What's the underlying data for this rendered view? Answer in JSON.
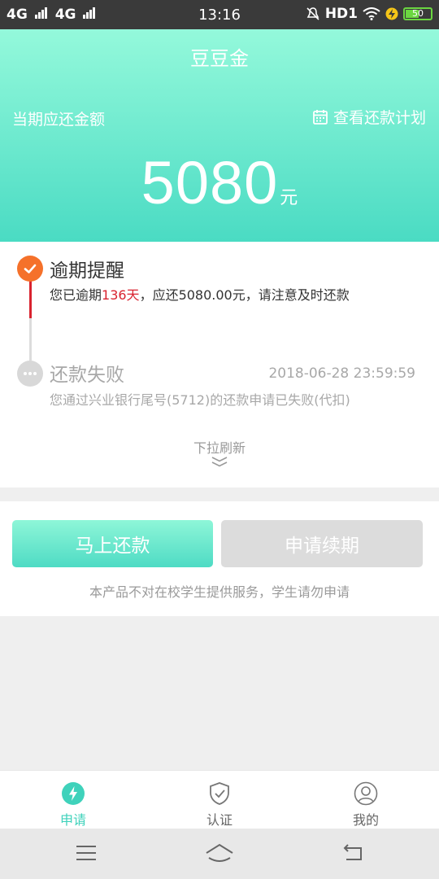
{
  "status_bar": {
    "network1": "4G",
    "network2": "4G",
    "time": "13:16",
    "hd_label": "HD1",
    "battery": "50"
  },
  "header": {
    "title": "豆豆金",
    "due_label": "当期应还金额",
    "plan_link": "查看还款计划",
    "amount": "5080",
    "amount_unit": "元"
  },
  "timeline": [
    {
      "title": "逾期提醒",
      "desc_prefix": "您已逾期",
      "desc_highlight": "136天",
      "desc_suffix": "，应还5080.00元，请注意及时还款"
    },
    {
      "title": "还款失败",
      "time": "2018-06-28 23:59:59",
      "desc": "您通过兴业银行尾号(5712)的还款申请已失败(代扣)"
    }
  ],
  "pull_refresh": "下拉刷新",
  "actions": {
    "repay_label": "马上还款",
    "extend_label": "申请续期",
    "notice": "本产品不对在校学生提供服务，学生请勿申请"
  },
  "bottom_nav": [
    {
      "label": "申请",
      "icon": "lightning-icon",
      "active": true
    },
    {
      "label": "认证",
      "icon": "shield-check-icon",
      "active": false
    },
    {
      "label": "我的",
      "icon": "user-icon",
      "active": false
    }
  ],
  "colors": {
    "accent": "#4adbc3",
    "overdue": "#d9232f",
    "warning_dot": "#f5712a"
  }
}
